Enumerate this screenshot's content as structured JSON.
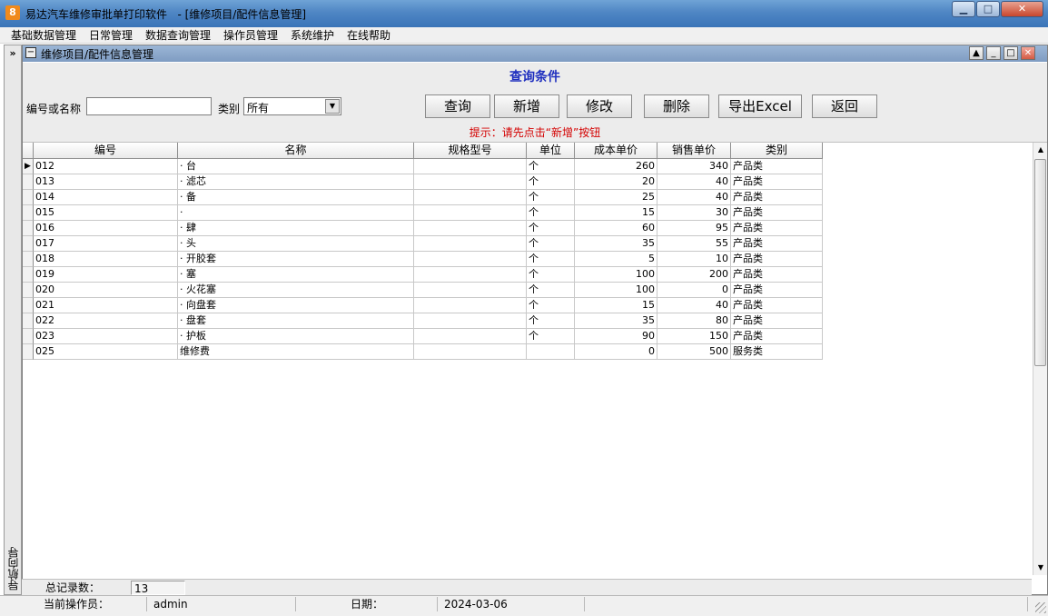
{
  "window": {
    "app_icon_glyph": "8",
    "title": "易达汽车维修审批单打印软件   - [维修项目/配件信息管理]",
    "min_glyph": "▁",
    "max_glyph": "□",
    "close_glyph": "✕"
  },
  "menu": [
    "基础数据管理",
    "日常管理",
    "数据查询管理",
    "操作员管理",
    "系统维护",
    "在线帮助"
  ],
  "nav": {
    "arrow": "»",
    "label": "导航向导"
  },
  "child": {
    "icon_glyph": "−",
    "title": "维修项目/配件信息管理",
    "up_glyph": "▲",
    "min_glyph": "_",
    "max_glyph": "□",
    "close_glyph": "✕"
  },
  "query": {
    "title": "查询条件",
    "code_label": "编号或名称",
    "code_value": "",
    "category_label": "类别",
    "category_value": "所有",
    "dropdown_glyph": "▼",
    "buttons": {
      "search": "查询",
      "add": "新增",
      "edit": "修改",
      "delete": "删除",
      "export": "导出Excel",
      "back": "返回"
    },
    "hint": "提示：请先点击“新增”按钮"
  },
  "table": {
    "columns": [
      "编号",
      "名称",
      "规格型号",
      "单位",
      "成本单价",
      "销售单价",
      "类别"
    ],
    "current_row_marker": "▶",
    "rows": [
      {
        "code": "012",
        "name": "‧ 台",
        "spec": "",
        "unit": "个",
        "cost": "260",
        "price": "340",
        "category": "产品类"
      },
      {
        "code": "013",
        "name": "‧ 滤芯",
        "spec": "",
        "unit": "个",
        "cost": "20",
        "price": "40",
        "category": "产品类"
      },
      {
        "code": "014",
        "name": "‧ 备",
        "spec": "",
        "unit": "个",
        "cost": "25",
        "price": "40",
        "category": "产品类"
      },
      {
        "code": "015",
        "name": "‧",
        "spec": "",
        "unit": "个",
        "cost": "15",
        "price": "30",
        "category": "产品类"
      },
      {
        "code": "016",
        "name": "‧ 肆",
        "spec": "",
        "unit": "个",
        "cost": "60",
        "price": "95",
        "category": "产品类"
      },
      {
        "code": "017",
        "name": "‧ 头",
        "spec": "",
        "unit": "个",
        "cost": "35",
        "price": "55",
        "category": "产品类"
      },
      {
        "code": "018",
        "name": "‧ 开胶套",
        "spec": "",
        "unit": "个",
        "cost": "5",
        "price": "10",
        "category": "产品类"
      },
      {
        "code": "019",
        "name": "‧ 塞",
        "spec": "",
        "unit": "个",
        "cost": "100",
        "price": "200",
        "category": "产品类"
      },
      {
        "code": "020",
        "name": "‧ 火花塞",
        "spec": "",
        "unit": "个",
        "cost": "100",
        "price": "0",
        "category": "产品类"
      },
      {
        "code": "021",
        "name": "‧ 向盘套",
        "spec": "",
        "unit": "个",
        "cost": "15",
        "price": "40",
        "category": "产品类"
      },
      {
        "code": "022",
        "name": "‧ 盘套",
        "spec": "",
        "unit": "个",
        "cost": "35",
        "price": "80",
        "category": "产品类"
      },
      {
        "code": "023",
        "name": "‧ 护板",
        "spec": "",
        "unit": "个",
        "cost": "90",
        "price": "150",
        "category": "产品类"
      },
      {
        "code": "025",
        "name": "维修费",
        "spec": "",
        "unit": "",
        "cost": "0",
        "price": "500",
        "category": "服务类"
      }
    ]
  },
  "scroll": {
    "up_glyph": "▲",
    "down_glyph": "▼",
    "thumb_glyph": "≡"
  },
  "summary": {
    "label": "总记录数：",
    "value": "13"
  },
  "status": {
    "operator_label": "当前操作员：",
    "operator_value": "admin",
    "date_label": "日期：",
    "date_value": "2024-03-06"
  }
}
